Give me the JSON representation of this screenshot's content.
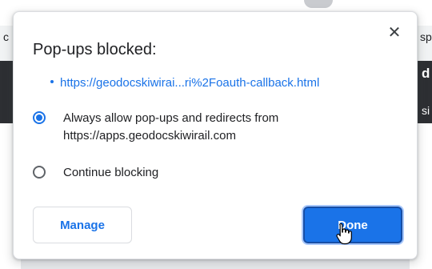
{
  "background": {
    "frag_c": "c",
    "frag_sp": "sp",
    "frag_d": "d",
    "frag_si": "si"
  },
  "dialog": {
    "close_glyph": "✕",
    "title": "Pop-ups blocked:",
    "blocked_url": "https://geodocskiwirai...ri%2Foauth-callback.html",
    "options": [
      {
        "label": "Always allow pop-ups and redirects from https://apps.geodocskiwirail.com",
        "checked": true
      },
      {
        "label": "Continue blocking",
        "checked": false
      }
    ],
    "manage_label": "Manage",
    "done_label": "Done"
  },
  "icons": {
    "close": "close-icon",
    "cursor": "hand-pointer-cursor-icon",
    "bullet": "bullet-dot-icon"
  },
  "colors": {
    "accent": "#1a73e8",
    "text": "#202124",
    "border": "#dadce0"
  }
}
